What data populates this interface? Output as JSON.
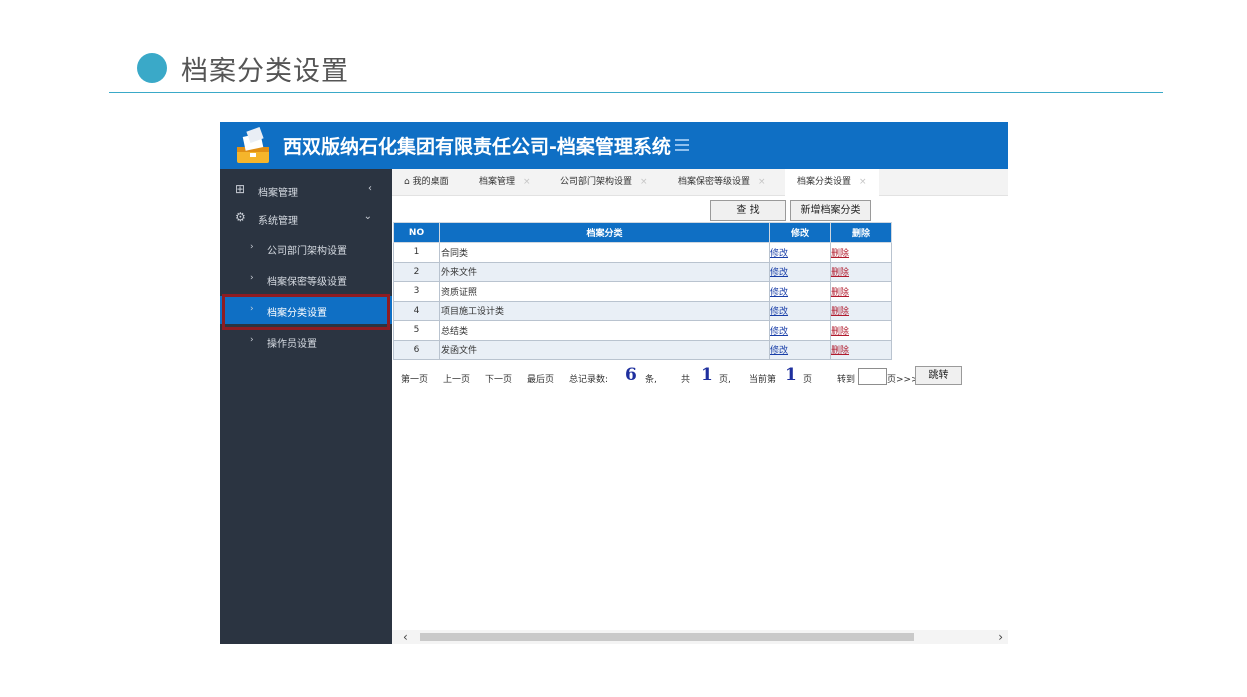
{
  "slide": {
    "title": "档案分类设置"
  },
  "app": {
    "title": "西双版纳石化集团有限责任公司-档案管理系统",
    "sidebar": [
      {
        "label": "档案管理",
        "icon": "grid-icon",
        "chevron": "‹"
      },
      {
        "label": "系统管理",
        "icon": "gear-icon",
        "chevron": "⌄"
      }
    ],
    "subitems": [
      {
        "label": "公司部门架构设置"
      },
      {
        "label": "档案保密等级设置"
      },
      {
        "label": "档案分类设置"
      },
      {
        "label": "操作员设置"
      }
    ],
    "tabs": [
      {
        "label": "我的桌面",
        "icon": "home-icon"
      },
      {
        "label": "档案管理",
        "close": "×"
      },
      {
        "label": "公司部门架构设置",
        "close": "×"
      },
      {
        "label": "档案保密等级设置",
        "close": "×"
      },
      {
        "label": "档案分类设置",
        "close": "×"
      }
    ],
    "buttons": {
      "search": "查 找",
      "add": "新增档案分类"
    },
    "table": {
      "headers": [
        "NO",
        "档案分类",
        "修改",
        "删除"
      ],
      "rows": [
        {
          "no": "1",
          "name": "合同类",
          "edit": "修改",
          "del": "删除"
        },
        {
          "no": "2",
          "name": "外来文件",
          "edit": "修改",
          "del": "删除"
        },
        {
          "no": "3",
          "name": "资质证照",
          "edit": "修改",
          "del": "删除"
        },
        {
          "no": "4",
          "name": "项目施工设计类",
          "edit": "修改",
          "del": "删除"
        },
        {
          "no": "5",
          "name": "总结类",
          "edit": "修改",
          "del": "删除"
        },
        {
          "no": "6",
          "name": "发函文件",
          "edit": "修改",
          "del": "删除"
        }
      ]
    },
    "pager": {
      "first": "第一页",
      "prev": "上一页",
      "next": "下一页",
      "last": "最后页",
      "total_label": "总记录数:",
      "total": "6",
      "total_unit": "条,",
      "pages_label": "共",
      "pages": "1",
      "pages_unit": "页,",
      "current_label": "当前第",
      "current": "1",
      "current_unit": "页",
      "goto_label": "转到",
      "goto_suffix": "页>>>",
      "goto_button": "跳转"
    },
    "colors": {
      "brand": "#0f6fc4",
      "sidebar": "#2b3441",
      "highlight": "#8e1c22",
      "accent": "#3aa9c8"
    }
  }
}
